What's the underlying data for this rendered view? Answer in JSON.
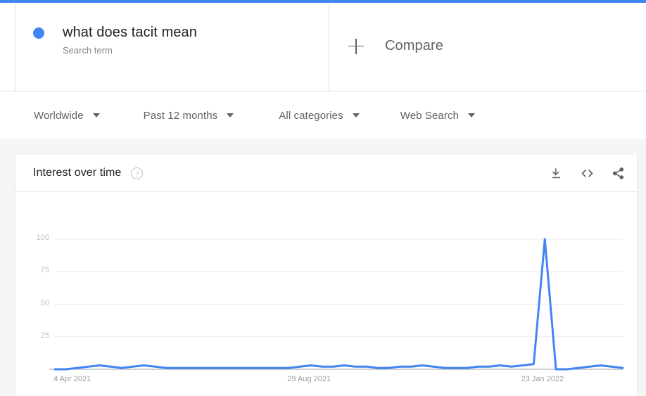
{
  "top_bar": {
    "color": "#4285f4"
  },
  "search_terms": [
    {
      "title": "what does tacit mean",
      "subtitle": "Search term",
      "color": "#4285f4",
      "dot_icon": "series-dot-icon"
    }
  ],
  "compare": {
    "label": "Compare",
    "icon": "plus-icon"
  },
  "filters": [
    {
      "label": "Worldwide",
      "icon": "chevron-down-icon"
    },
    {
      "label": "Past 12 months",
      "icon": "chevron-down-icon"
    },
    {
      "label": "All categories",
      "icon": "chevron-down-icon"
    },
    {
      "label": "Web Search",
      "icon": "chevron-down-icon"
    }
  ],
  "chart_card": {
    "title": "Interest over time",
    "help_icon": "help-circle-icon",
    "help_glyph": "?",
    "actions": [
      {
        "name": "download-icon",
        "label": "Download CSV"
      },
      {
        "name": "embed-code-icon",
        "label": "Embed"
      },
      {
        "name": "share-icon",
        "label": "Share"
      }
    ]
  },
  "chart_data": {
    "type": "line",
    "title": "Interest over time",
    "xlabel": "",
    "ylabel": "",
    "ylim": [
      0,
      100
    ],
    "grid": true,
    "legend_position": "none",
    "series_name": "what does tacit mean",
    "series_color": "#4285f4",
    "y_ticks": [
      100,
      75,
      50,
      25
    ],
    "x_ticks": [
      "4 Apr 2021",
      "29 Aug 2021",
      "23 Jan 2022"
    ],
    "x_tick_indices": [
      0,
      21,
      42
    ],
    "x": [
      "4 Apr 2021",
      "11 Apr 2021",
      "18 Apr 2021",
      "25 Apr 2021",
      "2 May 2021",
      "9 May 2021",
      "16 May 2021",
      "23 May 2021",
      "30 May 2021",
      "6 Jun 2021",
      "13 Jun 2021",
      "20 Jun 2021",
      "27 Jun 2021",
      "4 Jul 2021",
      "11 Jul 2021",
      "18 Jul 2021",
      "25 Jul 2021",
      "1 Aug 2021",
      "8 Aug 2021",
      "15 Aug 2021",
      "22 Aug 2021",
      "29 Aug 2021",
      "5 Sep 2021",
      "12 Sep 2021",
      "19 Sep 2021",
      "26 Sep 2021",
      "3 Oct 2021",
      "10 Oct 2021",
      "17 Oct 2021",
      "24 Oct 2021",
      "31 Oct 2021",
      "7 Nov 2021",
      "14 Nov 2021",
      "21 Nov 2021",
      "28 Nov 2021",
      "5 Dec 2021",
      "12 Dec 2021",
      "19 Dec 2021",
      "26 Dec 2021",
      "2 Jan 2022",
      "9 Jan 2022",
      "16 Jan 2022",
      "23 Jan 2022",
      "30 Jan 2022",
      "6 Feb 2022",
      "13 Feb 2022",
      "20 Feb 2022",
      "27 Feb 2022",
      "6 Mar 2022",
      "13 Mar 2022",
      "20 Mar 2022",
      "27 Mar 2022"
    ],
    "values": [
      0,
      0,
      1,
      2,
      3,
      2,
      1,
      2,
      3,
      2,
      1,
      1,
      1,
      1,
      1,
      1,
      1,
      1,
      1,
      1,
      1,
      1,
      2,
      3,
      2,
      2,
      3,
      2,
      2,
      1,
      1,
      2,
      2,
      3,
      2,
      1,
      1,
      1,
      2,
      2,
      3,
      2,
      3,
      4,
      100,
      0,
      0,
      1,
      2,
      3,
      2,
      1
    ],
    "peak": {
      "label": "23 Jan 2022",
      "value": 100
    }
  }
}
